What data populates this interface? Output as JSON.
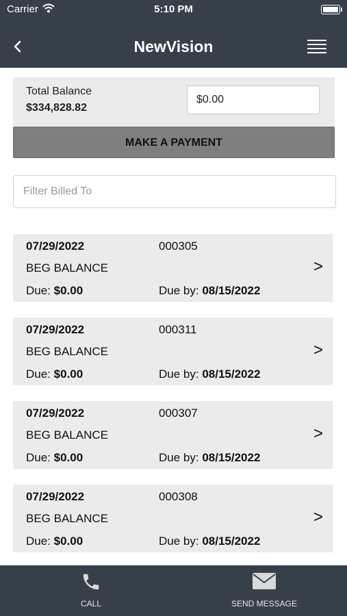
{
  "status_bar": {
    "carrier": "Carrier",
    "time": "5:10 PM"
  },
  "nav": {
    "title": "NewVision"
  },
  "balance": {
    "label": "Total Balance",
    "value": "$334,828.82",
    "payment_amount": "$0.00"
  },
  "actions": {
    "make_payment": "MAKE A PAYMENT"
  },
  "filter": {
    "placeholder": "Filter Billed To"
  },
  "bills": [
    {
      "date": "07/29/2022",
      "number": "000305",
      "description": "BEG BALANCE",
      "due_label": "Due:",
      "due": "$0.00",
      "due_by_label": "Due by:",
      "due_by": "08/15/2022",
      "chevron": ">"
    },
    {
      "date": "07/29/2022",
      "number": "000311",
      "description": "BEG BALANCE",
      "due_label": "Due:",
      "due": "$0.00",
      "due_by_label": "Due by:",
      "due_by": "08/15/2022",
      "chevron": ">"
    },
    {
      "date": "07/29/2022",
      "number": "000307",
      "description": "BEG BALANCE",
      "due_label": "Due:",
      "due": "$0.00",
      "due_by_label": "Due by:",
      "due_by": "08/15/2022",
      "chevron": ">"
    },
    {
      "date": "07/29/2022",
      "number": "000308",
      "description": "BEG BALANCE",
      "due_label": "Due:",
      "due": "$0.00",
      "due_by_label": "Due by:",
      "due_by": "08/15/2022",
      "chevron": ">"
    }
  ],
  "tabbar": {
    "call": {
      "label": "CALL",
      "icon": "phone-icon"
    },
    "message": {
      "label": "SEND MESSAGE",
      "icon": "envelope-icon"
    }
  },
  "colors": {
    "bar": "#374048",
    "panel": "#ebebeb",
    "button": "#7f7f7f"
  }
}
